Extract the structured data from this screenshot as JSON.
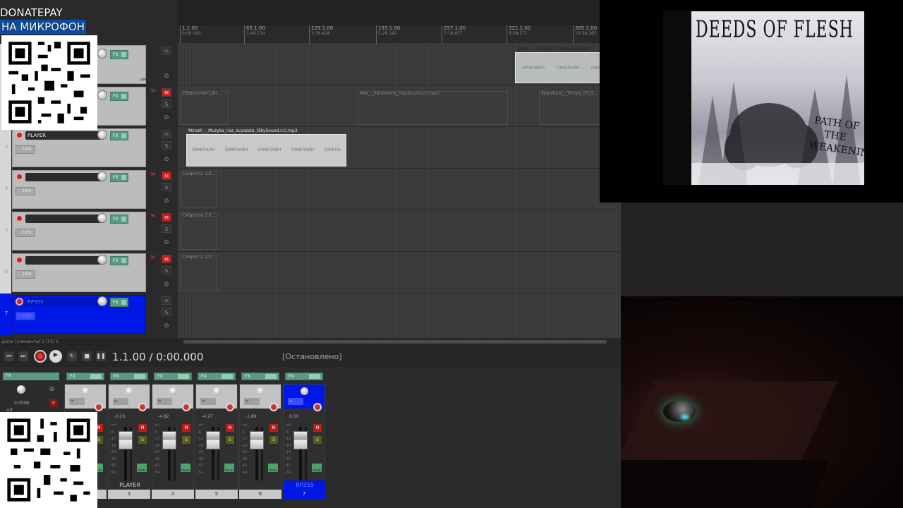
{
  "overlay": {
    "donate_line1": "DONATEPAY",
    "donate_line2": "НА МИКРОФОН"
  },
  "ruler": {
    "marks": [
      {
        "bar": "1.1.00",
        "time": "0:00.000"
      },
      {
        "bar": "65.1.00",
        "time": "1:49.714"
      },
      {
        "bar": "129.1.00",
        "time": "3:39.428"
      },
      {
        "bar": "193.1.00",
        "time": "5:29.142"
      },
      {
        "bar": "257.1.00",
        "time": "7:18.857"
      },
      {
        "bar": "321.1.00",
        "time": "9:08.571"
      },
      {
        "bar": "385.1.00",
        "time": "10:58.285"
      }
    ]
  },
  "tracks": [
    {
      "num": "",
      "name": "",
      "center_label": "центр",
      "armed": false
    },
    {
      "num": "",
      "name": "",
      "armed": true
    },
    {
      "num": "3",
      "name": "PLAYER",
      "trim": "trim",
      "armed": false
    },
    {
      "num": "4",
      "name": "",
      "trim": "trim",
      "armed": true
    },
    {
      "num": "5",
      "name": "",
      "trim": "trim",
      "armed": true
    },
    {
      "num": "6",
      "name": "",
      "trim": "trim",
      "armed": true
    },
    {
      "num": "7",
      "name": "RP355",
      "trim": "trim",
      "armed": false,
      "selected": true
    }
  ],
  "track_buttons": {
    "mute": "M",
    "solo": "S",
    "phase": "⊘",
    "fx": "FX"
  },
  "items": {
    "erotic": {
      "title": "Erotic_-_Max_Dont_Have_Sex_With",
      "offline": [
        "ОФФЛАЙН",
        "ОФФЛАЙН",
        "ОФФЛАЙН"
      ]
    },
    "ezdrummer": {
      "title": "EZdrummer Libr..."
    },
    "alfa": {
      "title": "Alfa_-_Zdravstvuj_(SkySound.cc).mp3"
    },
    "sepultura": {
      "title": "Sepultura_-_Troops_Of_D..."
    },
    "mirazh": {
      "title": "Mirazh_-_Muzyka_nas_svyazala_(SkySound.cc).mp3",
      "offline": [
        "ОФФЛАЙН",
        "ОФФЛАЙН",
        "ОФФЛАЙН",
        "ОФФЛАЙН",
        "ОФФЛА"
      ]
    },
    "speed4": {
      "title": "Скорость 1.0..."
    },
    "speed5": {
      "title": "Скорость 1.0..."
    },
    "speed6": {
      "title": "Скорость 1.0..."
    }
  },
  "statusline": "guitar [элементы] 1 [FX] 6",
  "transport": {
    "time": "1.1.00 / 0:00.000",
    "state": "[Остановлено]"
  },
  "mixer": {
    "master_db": "0.00dB",
    "master_inf": "-inf",
    "strips": [
      {
        "db": "-0.19",
        "name": "DRUMS",
        "num": "2"
      },
      {
        "db": "-0.23",
        "name": "PLAYER",
        "num": "3"
      },
      {
        "db": "-4.82",
        "name": "",
        "num": "4"
      },
      {
        "db": "-4.27",
        "name": "",
        "num": "5"
      },
      {
        "db": "-1.89",
        "name": "",
        "num": "6"
      },
      {
        "db": "0.00",
        "name": "RP355",
        "num": "7",
        "selected": true
      }
    ],
    "in_label": "in",
    "route_label": "Route",
    "scale": [
      "-inf",
      "-6",
      "-12",
      "-18",
      "-24",
      "-30",
      "-42",
      "-54"
    ]
  },
  "album": {
    "band": "DEEDS OF FLESH",
    "title": "PATH OF THE WEAKENING"
  },
  "colors": {
    "selected_track": "#0018e6",
    "mute_red": "#c71d1d",
    "fx_green": "#5a9a82"
  }
}
